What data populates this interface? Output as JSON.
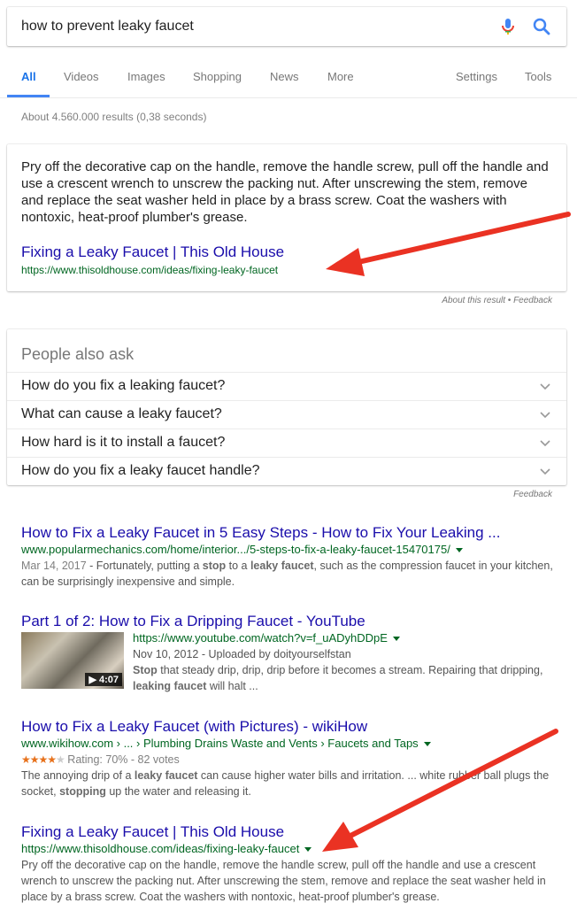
{
  "search": {
    "query": "how to prevent leaky faucet"
  },
  "tabs": {
    "left": [
      "All",
      "Videos",
      "Images",
      "Shopping",
      "News",
      "More"
    ],
    "right": [
      "Settings",
      "Tools"
    ]
  },
  "stats": "About 4.560.000 results (0,38 seconds)",
  "featured": {
    "text": "Pry off the decorative cap on the handle, remove the handle screw, pull off the handle and use a crescent wrench to unscrew the packing nut. After unscrewing the stem, remove and replace the seat washer held in place by a brass screw. Coat the washers with nontoxic, heat-proof plumber's grease.",
    "title": "Fixing a Leaky Faucet | This Old House",
    "url": "https://www.thisoldhouse.com/ideas/fixing-leaky-faucet",
    "about": "About this result • Feedback"
  },
  "paa": {
    "heading": "People also ask",
    "questions": [
      "How do you fix a leaking faucet?",
      "What can cause a leaky faucet?",
      "How hard is it to install a faucet?",
      "How do you fix a leaky faucet handle?"
    ],
    "feedback": "Feedback"
  },
  "results": [
    {
      "title": "How to Fix a Leaky Faucet in 5 Easy Steps - How to Fix Your Leaking ...",
      "url": "www.popularmechanics.com/home/interior.../5-steps-to-fix-a-leaky-faucet-15470175/",
      "date": "Mar 14, 2017",
      "snippet_parts": [
        " - Fortunately, putting a ",
        "stop",
        " to a ",
        "leaky faucet",
        ", such as the compression faucet in your kitchen, can be surprisingly inexpensive and simple."
      ]
    },
    {
      "title": "Part 1 of 2: How to Fix a Dripping Faucet - YouTube",
      "url": "https://www.youtube.com/watch?v=f_uADyhDDpE",
      "date": "Nov 10, 2012 - Uploaded by doityourselfstan",
      "duration": "4:07",
      "snippet_parts": [
        "Stop",
        " that steady drip, drip, drip before it becomes a stream. Repairing that dripping, ",
        "leaking faucet",
        " will halt ..."
      ]
    },
    {
      "title": "How to Fix a Leaky Faucet (with Pictures) - wikiHow",
      "url": "www.wikihow.com › ... › Plumbing Drains Waste and Vents › Faucets and Taps",
      "rating_text": "Rating: 70% - 82 votes",
      "rating": 3.5,
      "snippet_parts": [
        "The annoying drip of a ",
        "leaky faucet",
        " can cause higher water bills and irritation. ... white rubber ball plugs the socket, ",
        "stopping",
        " up the water and releasing it."
      ]
    },
    {
      "title": "Fixing a Leaky Faucet | This Old House",
      "url": "https://www.thisoldhouse.com/ideas/fixing-leaky-faucet",
      "snippet": "Pry off the decorative cap on the handle, remove the handle screw, pull off the handle and use a crescent wrench to unscrew the packing nut. After unscrewing the stem, remove and replace the seat washer held in place by a brass screw. Coat the washers with nontoxic, heat-proof plumber's grease."
    }
  ],
  "colors": {
    "link": "#1a0dab",
    "url": "#006621",
    "accent": "#4285f4",
    "arrow": "#ea3223"
  }
}
